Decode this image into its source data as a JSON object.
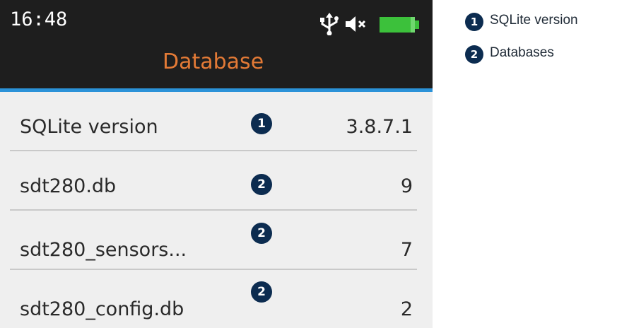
{
  "status_bar": {
    "time": "16:48",
    "icons": [
      "usb-icon",
      "mute-speaker-icon",
      "battery-icon"
    ],
    "battery_color": "#3cc13b"
  },
  "header": {
    "title": "Database"
  },
  "rows": [
    {
      "label": "SQLite version",
      "value": "3.8.7.1",
      "callout": "1"
    },
    {
      "label": "sdt280.db",
      "value": "9",
      "callout": "2"
    },
    {
      "label": "sdt280_sensors...",
      "value": "7",
      "callout": "2"
    },
    {
      "label": "sdt280_config.db",
      "value": "2",
      "callout": "2"
    }
  ],
  "legend": [
    {
      "number": "1",
      "text": "SQLite version"
    },
    {
      "number": "2",
      "text": "Databases"
    }
  ],
  "colors": {
    "title": "#e37a36",
    "accent_line": "#2b92d8",
    "callout_badge": "#0c2c50",
    "background": "#efefef",
    "status_bar": "#1e1e1e"
  }
}
